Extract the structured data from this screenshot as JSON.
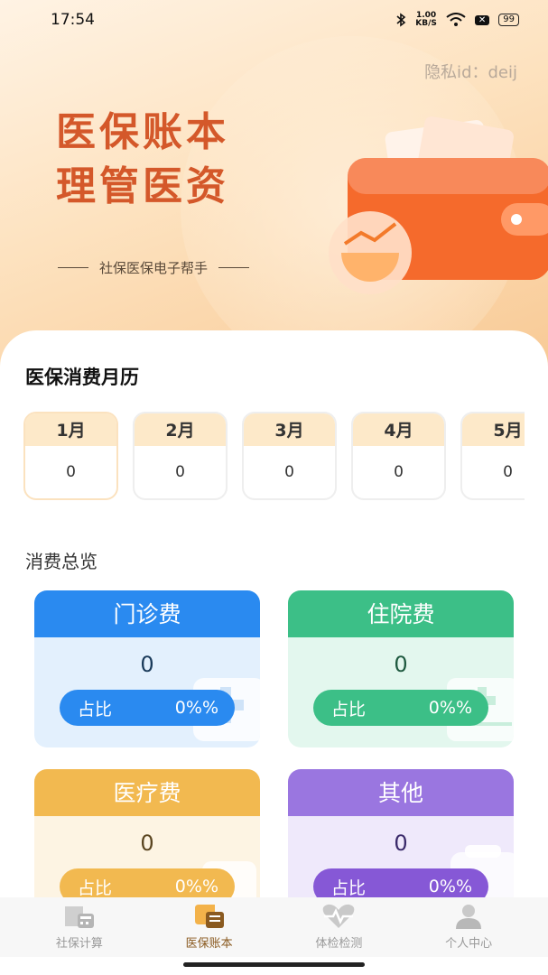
{
  "status_bar": {
    "time": "17:54",
    "net_speed_value": "1.00",
    "net_speed_unit": "KB/S",
    "battery": "99",
    "icons": [
      "bluetooth-icon",
      "wifi-icon",
      "x-badge-icon",
      "battery-icon"
    ]
  },
  "header": {
    "privacy_id": "隐私id：deij",
    "slogan_line1": "医保账本",
    "slogan_line2": "理管医资",
    "subtitle": "社保医保电子帮手"
  },
  "calendar": {
    "title": "医保消费月历",
    "months": [
      {
        "label": "1月",
        "value": "0"
      },
      {
        "label": "2月",
        "value": "0"
      },
      {
        "label": "3月",
        "value": "0"
      },
      {
        "label": "4月",
        "value": "0"
      },
      {
        "label": "5月",
        "value": "0"
      }
    ]
  },
  "overview": {
    "title": "消费总览",
    "categories": [
      {
        "name": "门诊费",
        "value": "0",
        "ratio_label": "占比",
        "ratio": "0%%",
        "color": "#2a8af0"
      },
      {
        "name": "住院费",
        "value": "0",
        "ratio_label": "占比",
        "ratio": "0%%",
        "color": "#3cbf87"
      },
      {
        "name": "医疗费",
        "value": "0",
        "ratio_label": "占比",
        "ratio": "0%%",
        "color": "#f2b950"
      },
      {
        "name": "其他",
        "value": "0",
        "ratio_label": "占比",
        "ratio": "0%%",
        "color": "#9a76e0"
      }
    ]
  },
  "tabbar": {
    "active": "医保账本",
    "tabs": [
      {
        "label": "社保计算",
        "icon": "calculator-icon"
      },
      {
        "label": "医保账本",
        "icon": "ledger-icon"
      },
      {
        "label": "体检检测",
        "icon": "heart-pulse-icon"
      },
      {
        "label": "个人中心",
        "icon": "person-icon"
      }
    ]
  }
}
